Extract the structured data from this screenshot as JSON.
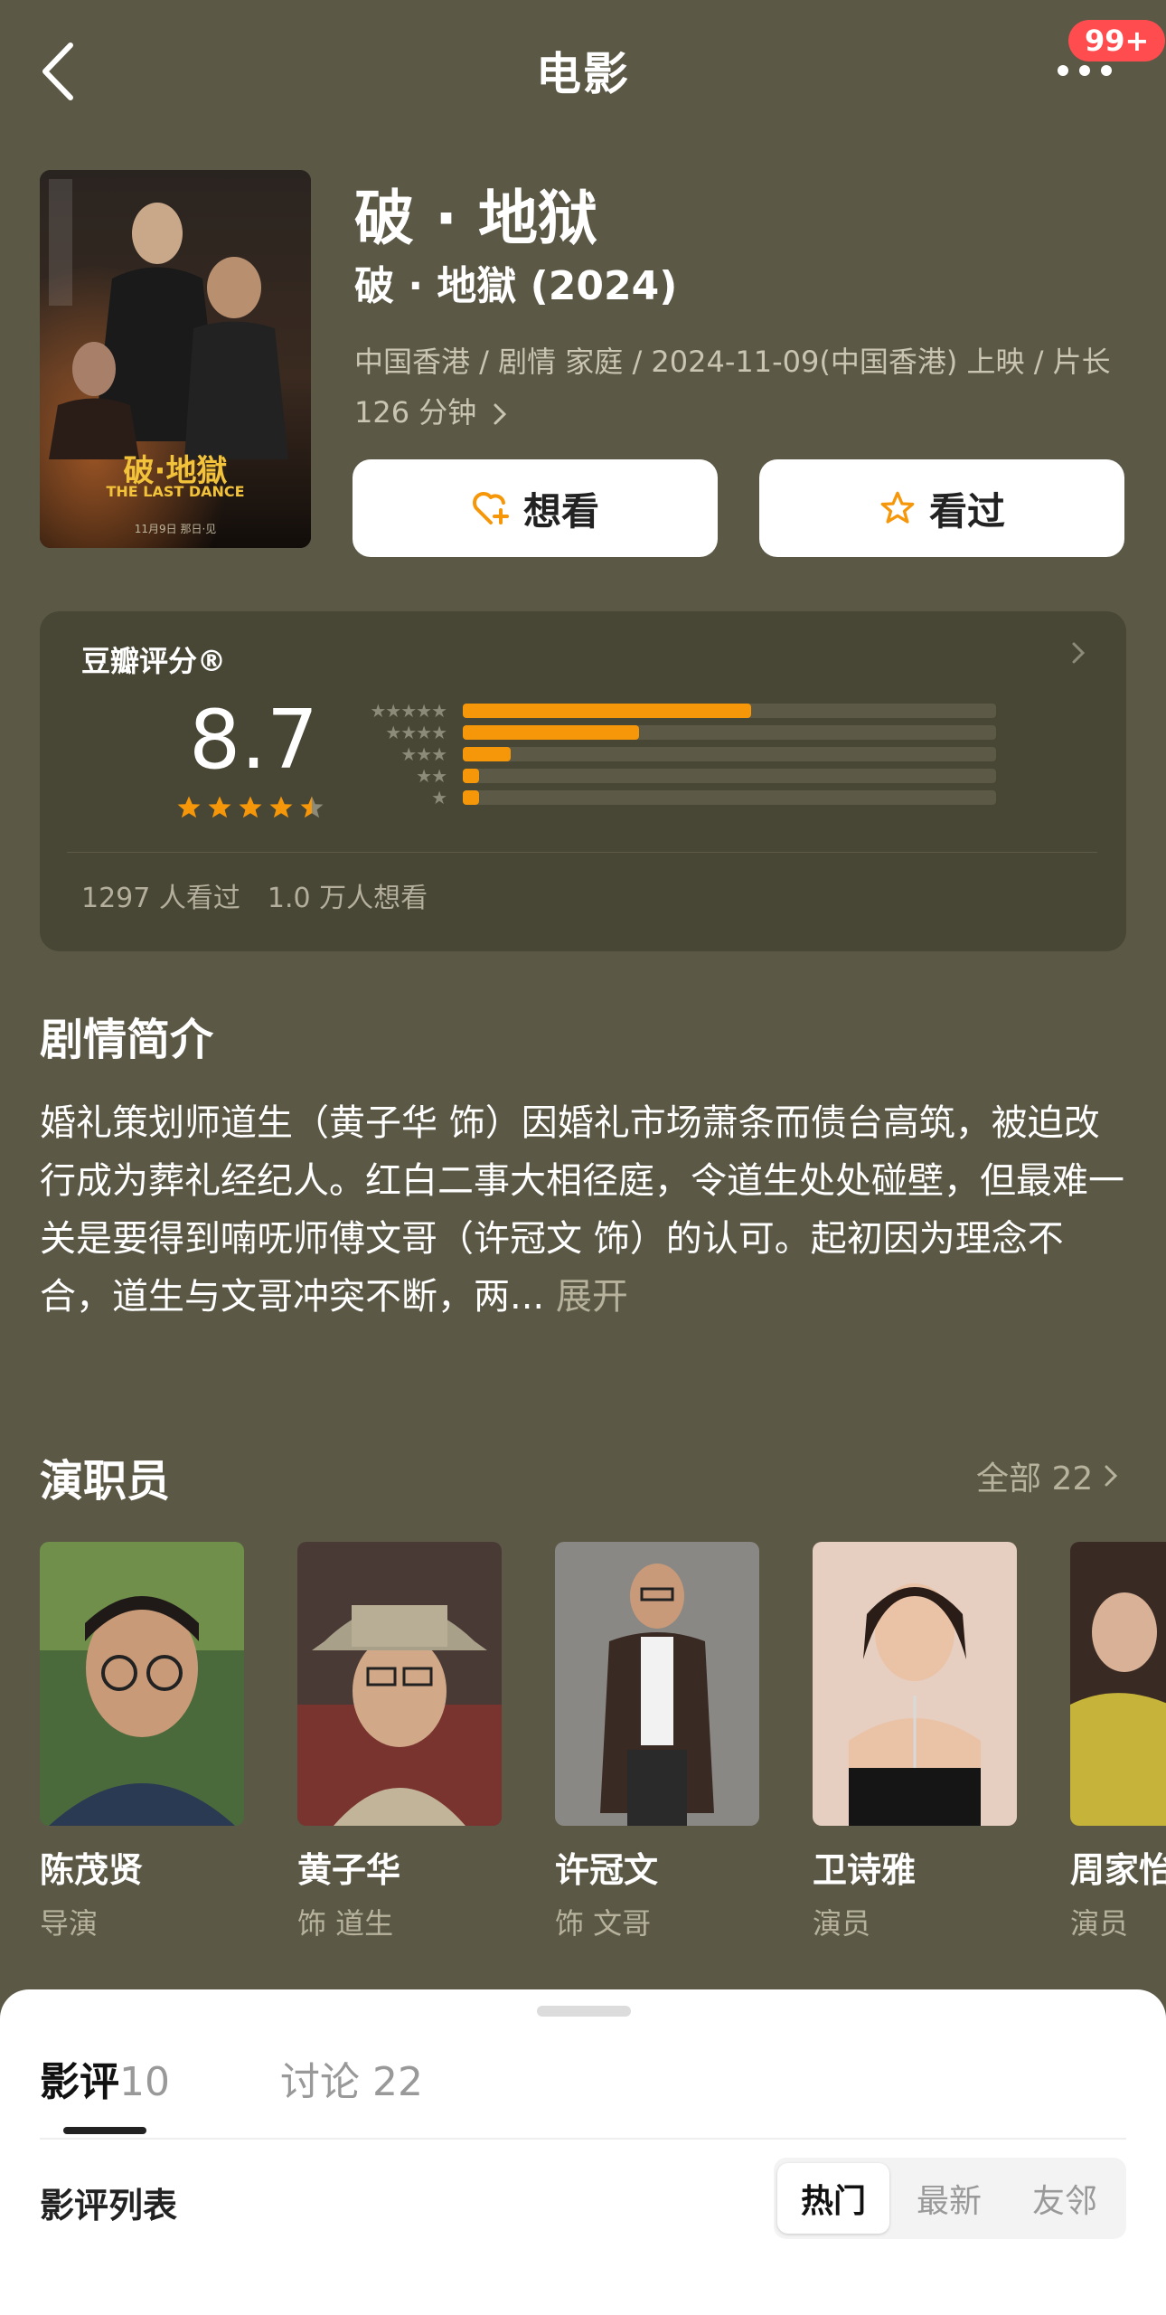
{
  "header": {
    "title": "电影",
    "badge": "99+",
    "back_icon": "chevron-left-icon",
    "more_icon": "more-dots-icon"
  },
  "poster": {
    "title": "破·地獄",
    "subtitle": "THE LAST DANCE",
    "date_text": "11月9日 那日·见"
  },
  "movie": {
    "title": "破 · 地狱",
    "subtitle": "破 · 地獄 (2024)",
    "meta": "中国香港 / 剧情 家庭 / 2024-11-09(中国香港) 上映 / 片长 126 分钟",
    "want_label": "想看",
    "watched_label": "看过",
    "colors": {
      "accent": "#f6970a"
    }
  },
  "rating": {
    "label": "豆瓣评分®",
    "score": "8.7",
    "star_rating": 4.5,
    "distribution": [
      {
        "stars": 5,
        "fraction": 0.54
      },
      {
        "stars": 4,
        "fraction": 0.33
      },
      {
        "stars": 3,
        "fraction": 0.09
      },
      {
        "stars": 2,
        "fraction": 0.03
      },
      {
        "stars": 1,
        "fraction": 0.03
      }
    ],
    "stats": "1297 人看过　1.0 万人想看"
  },
  "synopsis": {
    "title": "剧情简介",
    "text": "婚礼策划师道生（黄子华 饰）因婚礼市场萧条而债台高筑，被迫改行成为葬礼经纪人。红白二事大相径庭，令道生处处碰壁，但最难一关是要得到喃呒师傅文哥（许冠文 饰）的认可。起初因为理念不合，道生与文哥冲突不断，两...",
    "expand_label": "展开"
  },
  "cast": {
    "title": "演职员",
    "all_label": "全部 22",
    "members": [
      {
        "name": "陈茂贤",
        "role": "导演"
      },
      {
        "name": "黄子华",
        "role": "饰 道生"
      },
      {
        "name": "许冠文",
        "role": "饰 文哥"
      },
      {
        "name": "卫诗雅",
        "role": "演员"
      },
      {
        "name": "周家怡",
        "role": "演员"
      }
    ]
  },
  "reviews_sheet": {
    "tab_reviews": "影评",
    "tab_reviews_count": "10",
    "tab_discussion": "讨论 22",
    "list_label": "影评列表",
    "sort_options": [
      "热门",
      "最新",
      "友邻"
    ],
    "selected_sort": "热门"
  }
}
